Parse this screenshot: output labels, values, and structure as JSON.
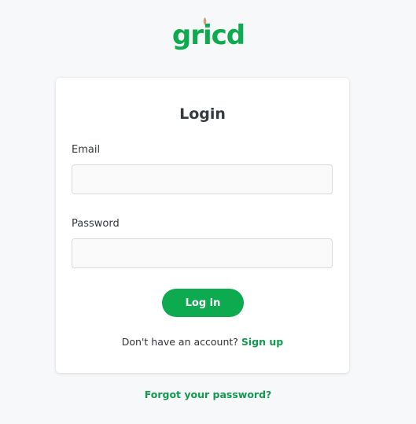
{
  "brand": {
    "logo_text": "gricd",
    "primary_color": "#0daa4f",
    "accent_color": "#c9a27a"
  },
  "login": {
    "title": "Login",
    "email_label": "Email",
    "email_value": "",
    "password_label": "Password",
    "password_value": "",
    "submit_label": "Log in",
    "signup_prompt": "Don't have an account?",
    "signup_link": "Sign up",
    "forgot_link": "Forgot your password?"
  }
}
